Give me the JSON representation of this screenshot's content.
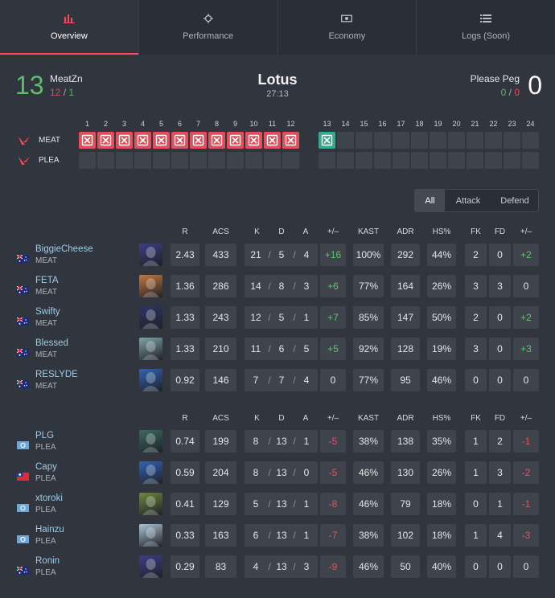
{
  "tabs": [
    {
      "label": "Overview",
      "icon": "bar-chart-icon",
      "active": true
    },
    {
      "label": "Performance",
      "icon": "crosshair-icon",
      "active": false
    },
    {
      "label": "Economy",
      "icon": "money-icon",
      "active": false
    },
    {
      "label": "Logs (Soon)",
      "icon": "list-icon",
      "active": false
    }
  ],
  "header": {
    "left_score": "13",
    "left_team": "MeatZn",
    "left_atk": "12",
    "left_sep": "/",
    "left_def": "1",
    "map": "Lotus",
    "time": "27:13",
    "right_score": "0",
    "right_team": "Please Peg",
    "right_atk": "0",
    "right_sep": "/",
    "right_def": "0"
  },
  "rounds": {
    "numbers": [
      "1",
      "2",
      "3",
      "4",
      "5",
      "6",
      "7",
      "8",
      "9",
      "10",
      "11",
      "12",
      "13",
      "14",
      "15",
      "16",
      "17",
      "18",
      "19",
      "20",
      "21",
      "22",
      "23",
      "24"
    ],
    "teams": [
      {
        "label": "MEAT",
        "logo": "valorant-logo-icon",
        "wins": [
          1,
          2,
          3,
          4,
          5,
          6,
          7,
          8,
          9,
          10,
          11,
          12,
          13
        ]
      },
      {
        "label": "PLEA",
        "logo": "valorant-logo-icon",
        "wins": []
      }
    ],
    "colors": {
      "attack_win": "#e0505b",
      "defense_win": "#3aa88e",
      "empty": "#3f444c"
    }
  },
  "filter": {
    "all": "All",
    "attack": "Attack",
    "defend": "Defend",
    "active": "All"
  },
  "columns": [
    "R",
    "ACS",
    "K",
    "D",
    "A",
    "+/–",
    "KAST",
    "ADR",
    "HS%",
    "FK",
    "FD",
    "+/–"
  ],
  "team1_players": [
    {
      "name": "BiggieCheese",
      "team": "MEAT",
      "flag": "au",
      "agent": "omen",
      "r": "2.43",
      "acs": "433",
      "k": "21",
      "d": "5",
      "a": "4",
      "pm": "+16",
      "kast": "100%",
      "adr": "292",
      "hs": "44%",
      "fk": "2",
      "fd": "0",
      "fpm": "+2"
    },
    {
      "name": "FETA",
      "team": "MEAT",
      "flag": "au",
      "agent": "kayo-orange",
      "r": "1.36",
      "acs": "286",
      "k": "14",
      "d": "8",
      "a": "3",
      "pm": "+6",
      "kast": "77%",
      "adr": "164",
      "hs": "26%",
      "fk": "3",
      "fd": "3",
      "fpm": "0"
    },
    {
      "name": "Swifty",
      "team": "MEAT",
      "flag": "au",
      "agent": "yoru",
      "r": "1.33",
      "acs": "243",
      "k": "12",
      "d": "5",
      "a": "1",
      "pm": "+7",
      "kast": "85%",
      "adr": "147",
      "hs": "50%",
      "fk": "2",
      "fd": "0",
      "fpm": "+2"
    },
    {
      "name": "Blessed",
      "team": "MEAT",
      "flag": "au",
      "agent": "sage",
      "r": "1.33",
      "acs": "210",
      "k": "11",
      "d": "6",
      "a": "5",
      "pm": "+5",
      "kast": "92%",
      "adr": "128",
      "hs": "19%",
      "fk": "3",
      "fd": "0",
      "fpm": "+3"
    },
    {
      "name": "RESLYDE",
      "team": "MEAT",
      "flag": "au",
      "agent": "neon",
      "r": "0.92",
      "acs": "146",
      "k": "7",
      "d": "7",
      "a": "4",
      "pm": "0",
      "kast": "77%",
      "adr": "95",
      "hs": "46%",
      "fk": "0",
      "fd": "0",
      "fpm": "0"
    }
  ],
  "team2_players": [
    {
      "name": "PLG",
      "team": "PLEA",
      "flag": "un",
      "agent": "harbor",
      "r": "0.74",
      "acs": "199",
      "k": "8",
      "d": "13",
      "a": "1",
      "pm": "-5",
      "kast": "38%",
      "adr": "138",
      "hs": "35%",
      "fk": "1",
      "fd": "2",
      "fpm": "-1"
    },
    {
      "name": "Capy",
      "team": "PLEA",
      "flag": "tw",
      "agent": "neon",
      "r": "0.59",
      "acs": "204",
      "k": "8",
      "d": "13",
      "a": "0",
      "pm": "-5",
      "kast": "46%",
      "adr": "130",
      "hs": "26%",
      "fk": "1",
      "fd": "3",
      "fpm": "-2"
    },
    {
      "name": "xtoroki",
      "team": "PLEA",
      "flag": "un",
      "agent": "skye",
      "r": "0.41",
      "acs": "129",
      "k": "5",
      "d": "13",
      "a": "1",
      "pm": "-8",
      "kast": "46%",
      "adr": "79",
      "hs": "18%",
      "fk": "0",
      "fd": "1",
      "fpm": "-1"
    },
    {
      "name": "Hainzu",
      "team": "PLEA",
      "flag": "un",
      "agent": "jett",
      "r": "0.33",
      "acs": "163",
      "k": "6",
      "d": "13",
      "a": "1",
      "pm": "-7",
      "kast": "38%",
      "adr": "102",
      "hs": "18%",
      "fk": "1",
      "fd": "4",
      "fpm": "-3"
    },
    {
      "name": "Ronin",
      "team": "PLEA",
      "flag": "au",
      "agent": "omen",
      "r": "0.29",
      "acs": "83",
      "k": "4",
      "d": "13",
      "a": "3",
      "pm": "-9",
      "kast": "46%",
      "adr": "50",
      "hs": "40%",
      "fk": "0",
      "fd": "0",
      "fpm": "0"
    }
  ]
}
